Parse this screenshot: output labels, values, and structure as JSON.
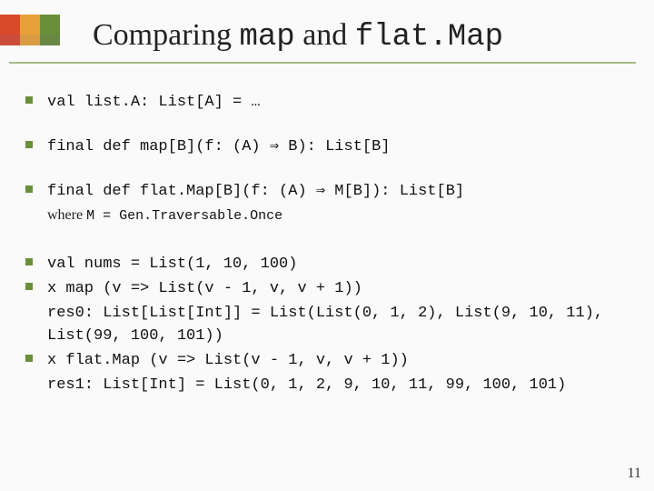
{
  "title": {
    "part1": "Comparing ",
    "code1": "map",
    "part2": " and ",
    "code2": "flat.Map"
  },
  "lines": {
    "l1": "val list.A: List[A] = …",
    "l2": "final def     map[B](f: (A) ⇒   B):  List[B]",
    "l3": "final def flat.Map[B](f: (A) ⇒ M[B]): List[B]",
    "where_plain": "where ",
    "where_code": "M = Gen.Traversable.Once",
    "l4": "val nums = List(1, 10, 100)",
    "l5a": "x map (v => List(v - 1, v, v + 1))",
    "l5b": "res0: List[List[Int]] = List(List(0, 1, 2), List(9, 10, 11), List(99, 100, 101))",
    "l6a": "x flat.Map (v => List(v - 1, v, v + 1))",
    "l6b": "res1: List[Int] = List(0, 1, 2, 9, 10, 11, 99, 100, 101)"
  },
  "page_number": "11"
}
